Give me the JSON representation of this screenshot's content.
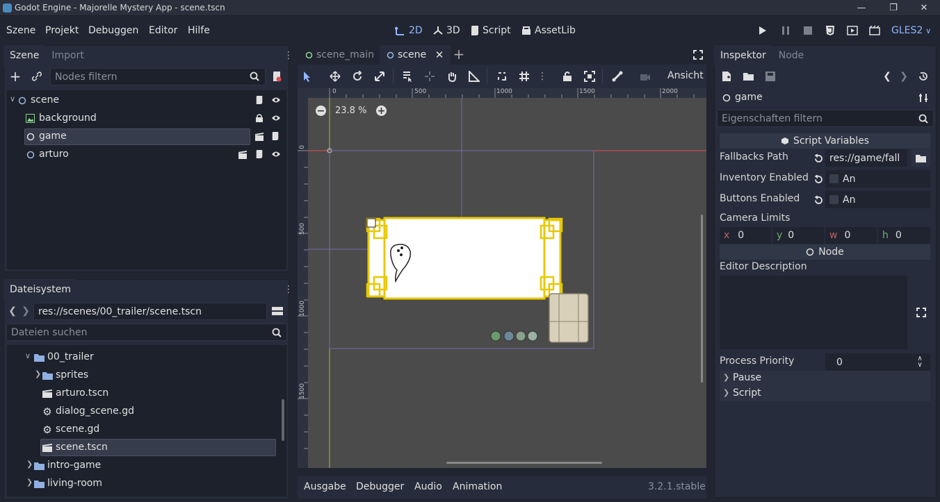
{
  "window": {
    "title": "Godot Engine - Majorelle Mystery App - scene.tscn"
  },
  "menus": [
    "Szene",
    "Projekt",
    "Debuggen",
    "Editor",
    "Hilfe"
  ],
  "modes": [
    {
      "label": "2D",
      "icon": "2d-icon"
    },
    {
      "label": "3D",
      "icon": "3d-icon"
    },
    {
      "label": "Script",
      "icon": "script-icon"
    },
    {
      "label": "AssetLib",
      "icon": "assetlib-icon"
    }
  ],
  "renderer": "GLES2",
  "scene_dock": {
    "tabs": [
      "Szene",
      "Import"
    ],
    "filter_placeholder": "Nodes filtern",
    "nodes": [
      {
        "label": "scene"
      },
      {
        "label": "background"
      },
      {
        "label": "game"
      },
      {
        "label": "arturo"
      }
    ]
  },
  "filesystem": {
    "tab": "Dateisystem",
    "path": "res://scenes/00_trailer/scene.tscn",
    "search_placeholder": "Dateien suchen",
    "items": [
      {
        "label": "00_trailer"
      },
      {
        "label": "sprites"
      },
      {
        "label": "arturo.tscn"
      },
      {
        "label": "dialog_scene.gd"
      },
      {
        "label": "scene.gd"
      },
      {
        "label": "scene.tscn"
      },
      {
        "label": "intro-game"
      },
      {
        "label": "living-room"
      }
    ]
  },
  "editor": {
    "tabs": [
      "scene_main",
      "scene"
    ],
    "view_label": "Ansicht",
    "zoom": "23.8 %",
    "ruler_x": [
      "0",
      "500",
      "1000",
      "1500",
      "2000"
    ],
    "ruler_y": [
      "0",
      "500",
      "1000",
      "1500"
    ]
  },
  "bottom": {
    "tabs": [
      "Ausgabe",
      "Debugger",
      "Audio",
      "Animation"
    ],
    "version": "3.2.1.stable"
  },
  "inspector": {
    "tabs": [
      "Inspektor",
      "Node"
    ],
    "node_name": "game",
    "filter_placeholder": "Eigenschaften filtern",
    "section_script_vars": "Script Variables",
    "fallbacks_path_label": "Fallbacks Path",
    "fallbacks_path_value": "res://game/fall",
    "inventory_label": "Inventory Enabled",
    "inventory_value": "An",
    "buttons_label": "Buttons Enabled",
    "buttons_value": "An",
    "camera_limits_label": "Camera Limits",
    "camera": [
      {
        "axis": "x",
        "value": "0"
      },
      {
        "axis": "y",
        "value": "0"
      },
      {
        "axis": "w",
        "value": "0"
      },
      {
        "axis": "h",
        "value": "0"
      }
    ],
    "section_node": "Node",
    "editor_description_label": "Editor Description",
    "process_priority_label": "Process Priority",
    "process_priority_value": "0",
    "groups": [
      "Pause",
      "Script"
    ]
  },
  "colors": {
    "accent": "#8fb6ff",
    "bg": "#202531",
    "panel": "#262c3b",
    "x_axis": "#e05050",
    "y_axis": "#8cc63f"
  }
}
